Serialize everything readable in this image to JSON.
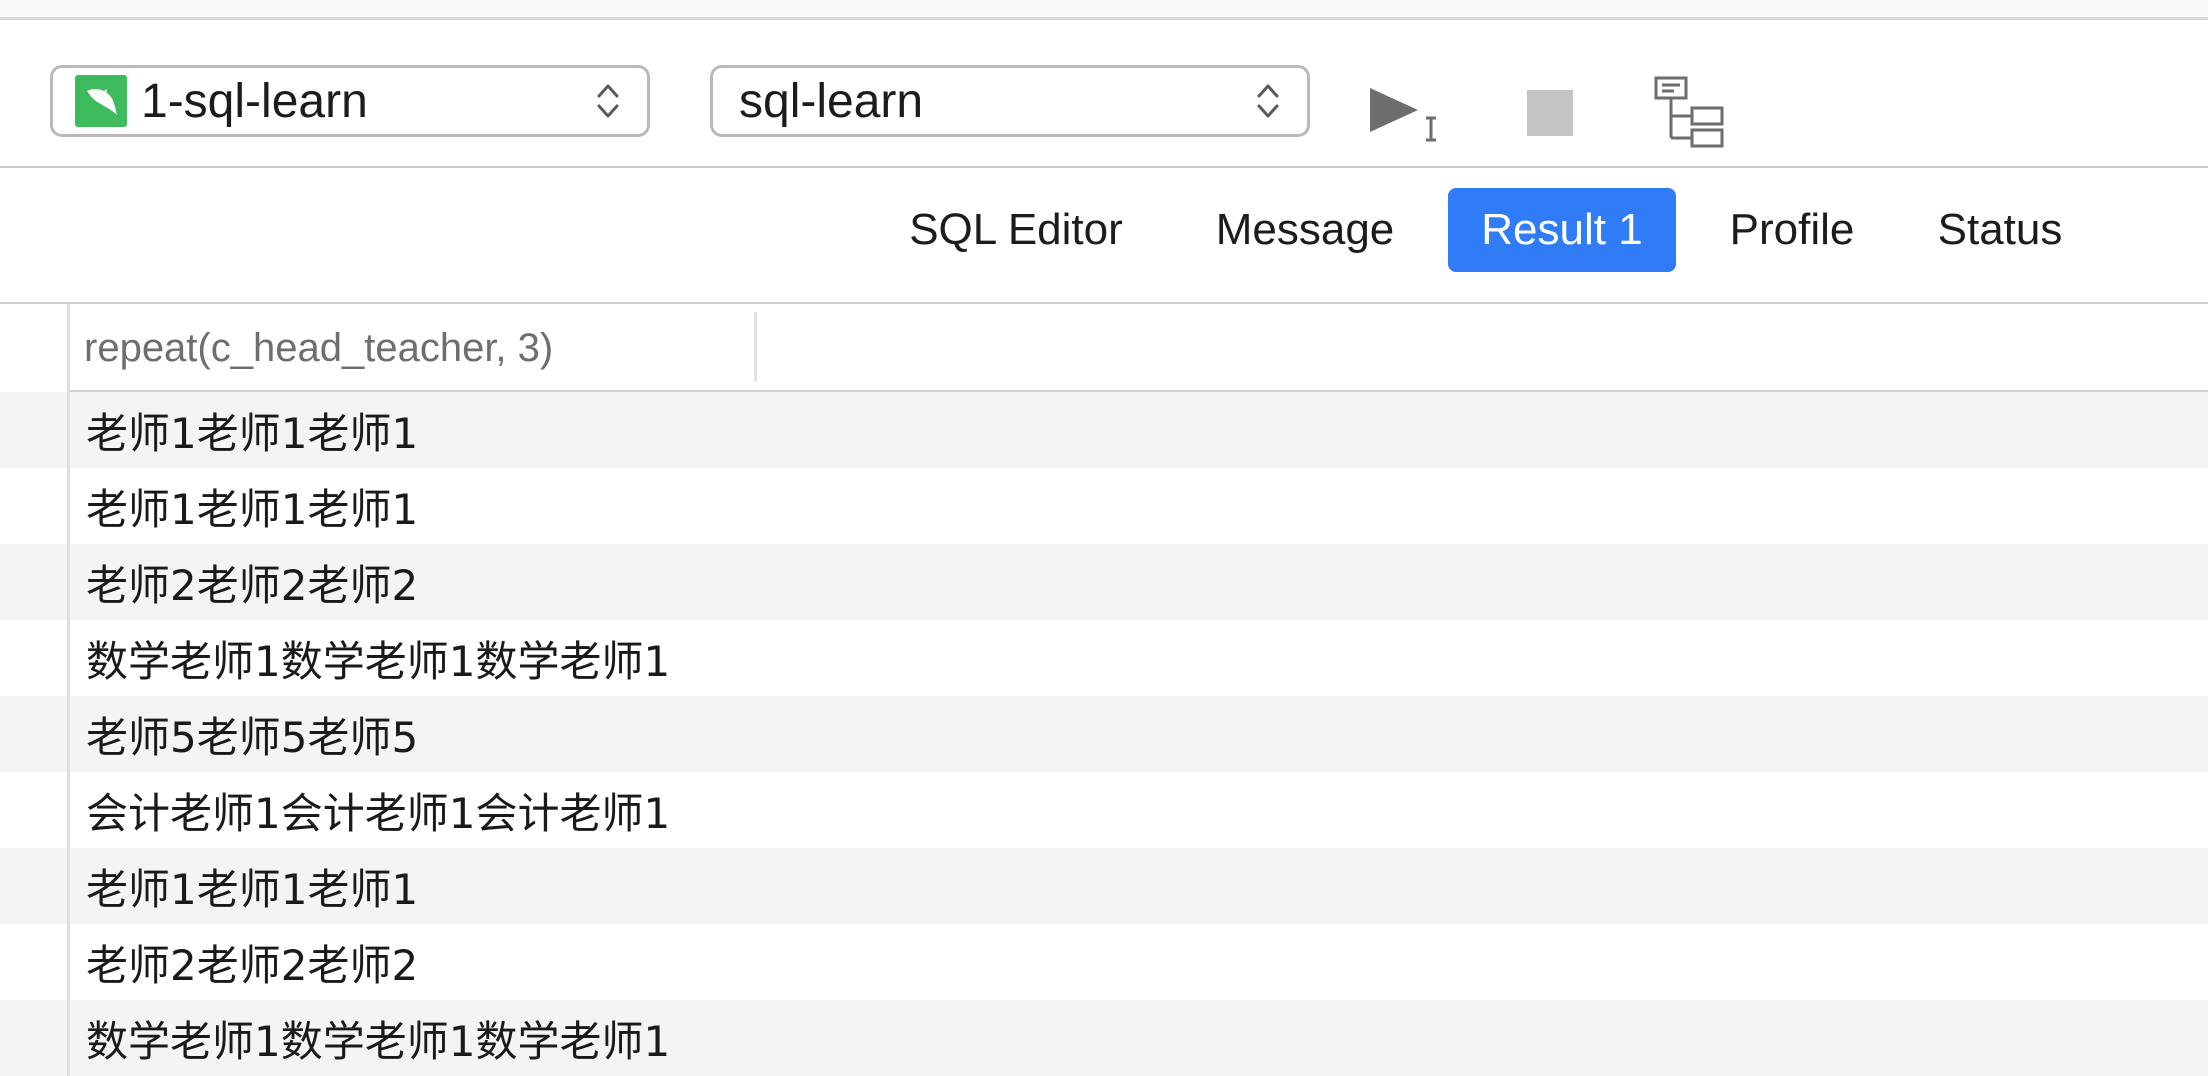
{
  "toolbar": {
    "connection": {
      "label": "1-sql-learn",
      "icon": "mysql-dolphin-icon"
    },
    "database": {
      "label": "sql-learn"
    },
    "tools": {
      "run": "run-query-icon",
      "stop": "stop-icon",
      "explain": "explain-icon"
    }
  },
  "tabs": [
    {
      "label": "SQL Editor",
      "active": false
    },
    {
      "label": "Message",
      "active": false
    },
    {
      "label": "Result 1",
      "active": true
    },
    {
      "label": "Profile",
      "active": false
    },
    {
      "label": "Status",
      "active": false
    }
  ],
  "result": {
    "columns": [
      "repeat(c_head_teacher, 3)"
    ],
    "rows": [
      "老师1老师1老师1",
      "老师1老师1老师1",
      "老师2老师2老师2",
      "数学老师1数学老师1数学老师1",
      "老师5老师5老师5",
      "会计老师1会计老师1会计老师1",
      "老师1老师1老师1",
      "老师2老师2老师2",
      "数学老师1数学老师1数学老师1"
    ]
  },
  "colors": {
    "accent": "#2f7cf6",
    "db_icon": "#3dbb5d",
    "row_alt": "#f4f4f4"
  }
}
